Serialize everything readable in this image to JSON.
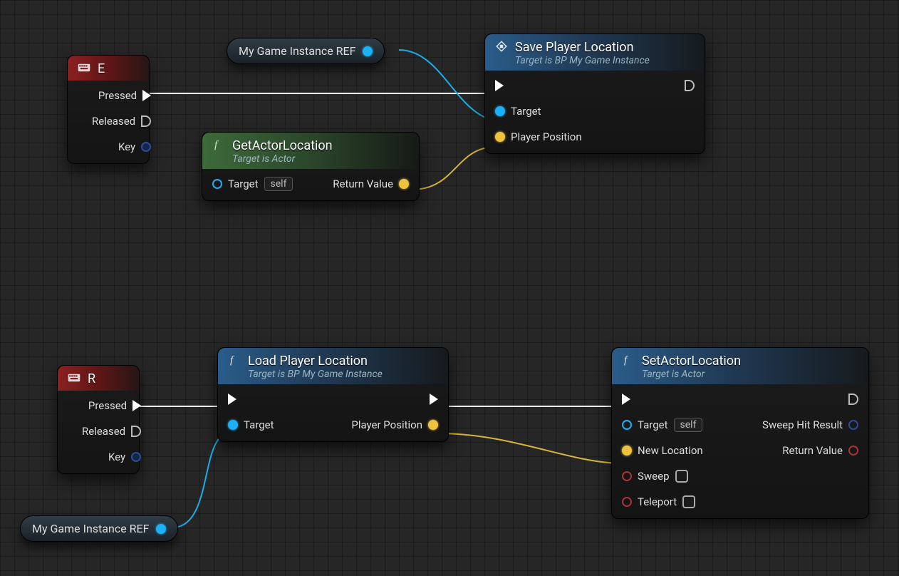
{
  "refPill1": {
    "label": "My Game Instance REF"
  },
  "refPill2": {
    "label": "My Game Instance REF"
  },
  "nodeE": {
    "title": "E",
    "pins": {
      "pressed": "Pressed",
      "released": "Released",
      "key": "Key"
    }
  },
  "nodeR": {
    "title": "R",
    "pins": {
      "pressed": "Pressed",
      "released": "Released",
      "key": "Key"
    }
  },
  "getActorLoc": {
    "title": "GetActorLocation",
    "sub": "Target is Actor",
    "pins": {
      "target": "Target",
      "self": "self",
      "ret": "Return Value"
    }
  },
  "savePlayerLoc": {
    "title": "Save Player Location",
    "sub": "Target is BP My Game Instance",
    "pins": {
      "target": "Target",
      "ppos": "Player Position"
    }
  },
  "loadPlayerLoc": {
    "title": "Load Player Location",
    "sub": "Target is BP My Game Instance",
    "pins": {
      "target": "Target",
      "ppos": "Player Position"
    }
  },
  "setActorLoc": {
    "title": "SetActorLocation",
    "sub": "Target is Actor",
    "pins": {
      "target": "Target",
      "self": "self",
      "newloc": "New Location",
      "sweep": "Sweep",
      "teleport": "Teleport",
      "sweephit": "Sweep Hit Result",
      "ret": "Return Value"
    }
  }
}
